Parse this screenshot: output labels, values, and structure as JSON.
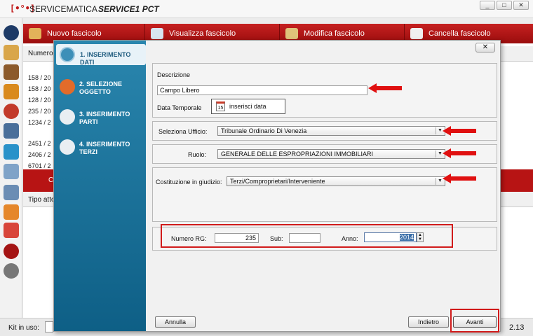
{
  "app": {
    "logo": "[•°•]",
    "name": "SERVICEMATICA",
    "product": "SERVICE1 PCT",
    "min_label": "_",
    "max_label": "□",
    "close_label": "✕"
  },
  "ribbon": {
    "tabs": [
      {
        "label": "Nuovo fascicolo",
        "icon": "pencil-icon"
      },
      {
        "label": "Visualizza fascicolo",
        "icon": "eye-icon"
      },
      {
        "label": "Modifica fascicolo",
        "icon": "edit-icon"
      },
      {
        "label": "Cancella fascicolo",
        "icon": "delete-icon"
      }
    ]
  },
  "background": {
    "table_header": "Numero",
    "rows": [
      "158 / 20",
      "158 / 20",
      "128 / 20",
      "235 / 20",
      "1234 / 2",
      "2451 / 2",
      "2406 / 2",
      "6701 / 2"
    ],
    "red_section_label": "C",
    "tipo_header": "Tipo atto"
  },
  "status": {
    "kit_label": "Kit in uso:",
    "version": "2.13"
  },
  "wizard": {
    "steps": [
      {
        "label": "1. INSERIMENTO DATI",
        "active": true
      },
      {
        "label": "2. SELEZIONE OGGETTO",
        "active": false
      },
      {
        "label": "3. INSERIMENTO PARTI",
        "active": false
      },
      {
        "label": "4. INSERIMENTO TERZI",
        "active": false
      }
    ]
  },
  "dialog": {
    "close_label": "✕",
    "descrizione_label": "Descrizione",
    "descrizione_value": "Campo Libero",
    "data_temporale_label": "Data Temporale",
    "data_button_label": "inserisci data",
    "calendar_day": "15",
    "ufficio_label": "Seleziona Ufficio:",
    "ufficio_value": "Tribunale Ordinario Di Venezia",
    "ruolo_label": "Ruolo:",
    "ruolo_value": "GENERALE DELLE ESPROPRIAZIONI IMMOBILIARI",
    "costituzione_label": "Costituzione in giudizio:",
    "costituzione_value": "Terzi/Comproprietari/Interveniente",
    "numero_rg_label": "Numero RG:",
    "numero_rg_value": "235",
    "sub_label": "Sub:",
    "sub_value": "",
    "anno_label": "Anno:",
    "anno_value": "2014",
    "annulla_label": "Annulla",
    "indietro_label": "Indietro",
    "avanti_label": "Avanti"
  },
  "colors": {
    "accent_red": "#c01b1b",
    "wizard_blue": "#1a6f96",
    "highlight_red": "#d11b1b"
  }
}
